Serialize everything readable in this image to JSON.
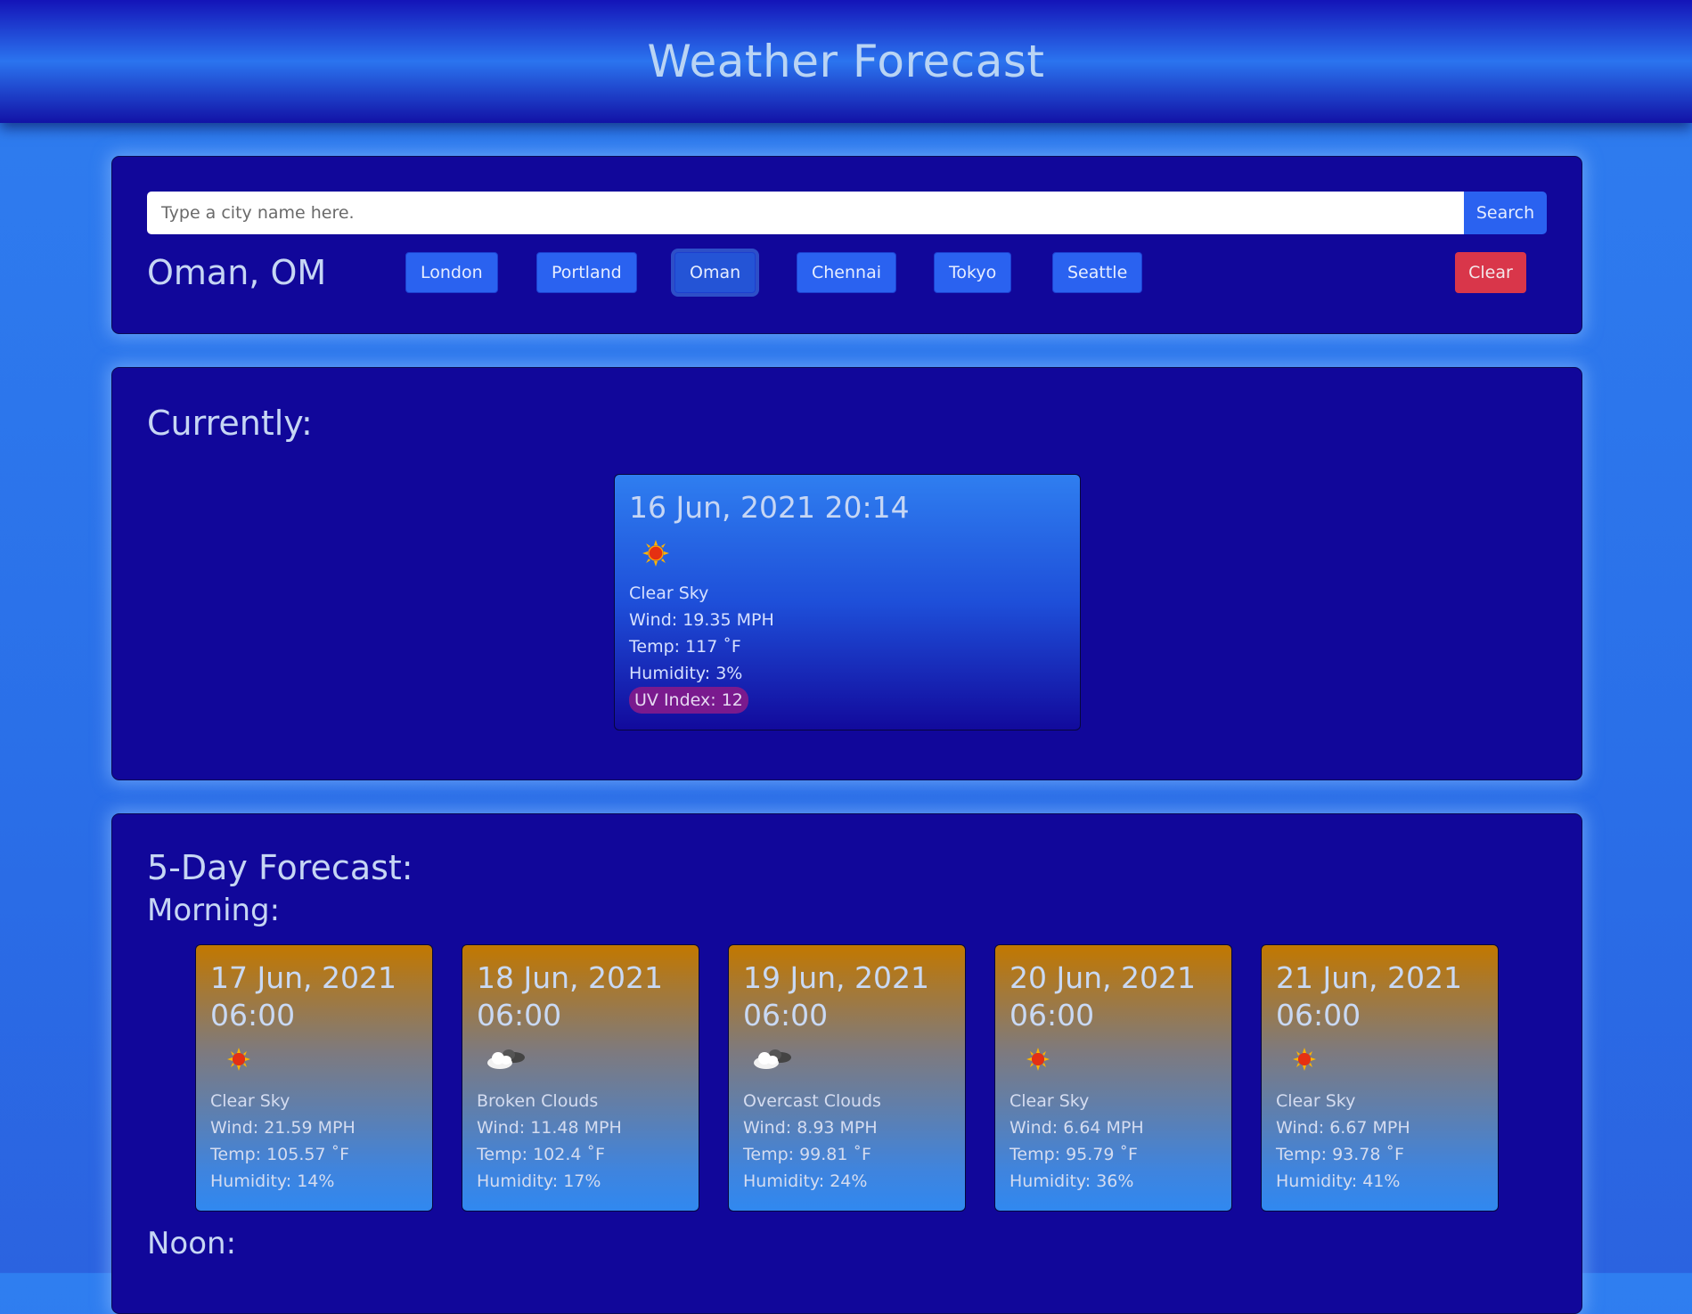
{
  "header": {
    "title": "Weather Forecast"
  },
  "search": {
    "placeholder": "Type a city name here.",
    "button_label": "Search"
  },
  "city": {
    "title": "Oman, OM"
  },
  "history": [
    {
      "label": "London"
    },
    {
      "label": "Portland"
    },
    {
      "label": "Oman",
      "active": true
    },
    {
      "label": "Chennai"
    },
    {
      "label": "Tokyo"
    },
    {
      "label": "Seattle"
    }
  ],
  "clear_label": "Clear",
  "current": {
    "heading": "Currently:",
    "date": "16 Jun, 2021 20:14",
    "icon": "sun-icon",
    "description": "Clear Sky",
    "wind": "Wind: 19.35 MPH",
    "temp": "Temp: 117 ˚F",
    "humidity": "Humidity: 3%",
    "uv": "UV Index: 12",
    "uv_color": "#7a1a8e"
  },
  "forecast": {
    "heading": "5-Day Forecast:",
    "morning_heading": "Morning:",
    "noon_heading": "Noon:",
    "days": [
      {
        "date": "17 Jun, 2021",
        "time": "06:00",
        "icon": "sun-icon",
        "description": "Clear Sky",
        "wind": "Wind: 21.59 MPH",
        "temp": "Temp: 105.57 ˚F",
        "humidity": "Humidity: 14%"
      },
      {
        "date": "18 Jun, 2021",
        "time": "06:00",
        "icon": "clouds-icon",
        "description": "Broken Clouds",
        "wind": "Wind: 11.48 MPH",
        "temp": "Temp: 102.4 ˚F",
        "humidity": "Humidity: 17%"
      },
      {
        "date": "19 Jun, 2021",
        "time": "06:00",
        "icon": "clouds-icon",
        "description": "Overcast Clouds",
        "wind": "Wind: 8.93 MPH",
        "temp": "Temp: 99.81 ˚F",
        "humidity": "Humidity: 24%"
      },
      {
        "date": "20 Jun, 2021",
        "time": "06:00",
        "icon": "sun-icon",
        "description": "Clear Sky",
        "wind": "Wind: 6.64 MPH",
        "temp": "Temp: 95.79 ˚F",
        "humidity": "Humidity: 36%"
      },
      {
        "date": "21 Jun, 2021",
        "time": "06:00",
        "icon": "sun-icon",
        "description": "Clear Sky",
        "wind": "Wind: 6.67 MPH",
        "temp": "Temp: 93.78 ˚F",
        "humidity": "Humidity: 41%"
      }
    ]
  },
  "colors": {
    "panel_bg": "#11079a",
    "button_blue": "#2a62f0",
    "clear_red": "#d9364a"
  }
}
